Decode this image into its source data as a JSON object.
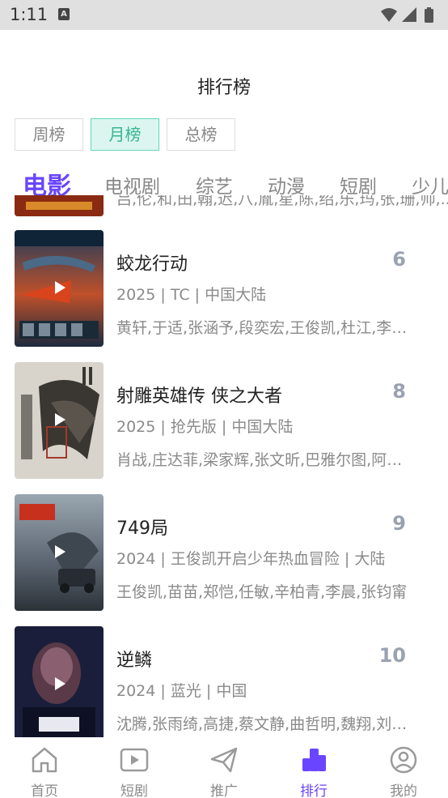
{
  "status_bar": {
    "time": "1:11",
    "notif_letter": "A"
  },
  "page_title": "排行榜",
  "period_tabs": [
    {
      "label": "周榜",
      "active": false
    },
    {
      "label": "月榜",
      "active": true
    },
    {
      "label": "总榜",
      "active": false
    }
  ],
  "category_tabs": [
    {
      "label": "电影",
      "active": true
    },
    {
      "label": "电视剧",
      "active": false
    },
    {
      "label": "综艺",
      "active": false
    },
    {
      "label": "动漫",
      "active": false
    },
    {
      "label": "短剧",
      "active": false
    },
    {
      "label": "少儿",
      "active": false
    }
  ],
  "partial_item": {
    "cast": "吕,伦,和,田,翰,迟,八,胤,星,陈,绍,乐,玛,张,珊,帅,..."
  },
  "items": [
    {
      "title": "蛟龙行动",
      "rank": "6",
      "meta": "2025 | TC | 中国大陆",
      "cast": "黄轩,于适,张涵予,段奕宏,王俊凯,杜江,李晨,彭昱畅"
    },
    {
      "title": "射雕英雄传 侠之大者",
      "rank": "8",
      "meta": "2025 | 抢先版 | 中国大陆",
      "cast": "肖战,庄达菲,梁家辉,张文昕,巴雅尔图,阿如那,胡军"
    },
    {
      "title": "749局",
      "rank": "9",
      "meta": "2024 | 王俊凯开启少年热血冒险 | 大陆",
      "cast": "王俊凯,苗苗,郑恺,任敏,辛柏青,李晨,张钧甯"
    },
    {
      "title": "逆鳞",
      "rank": "10",
      "meta": "2024 | 蓝光 | 中国",
      "cast": "沈腾,张雨绮,高捷,蔡文静,曲哲明,魏翔,刘晓晔"
    }
  ],
  "bottom_nav": [
    {
      "label": "首页",
      "icon": "home-icon",
      "active": false
    },
    {
      "label": "短剧",
      "icon": "play-square-icon",
      "active": false
    },
    {
      "label": "推广",
      "icon": "paper-plane-icon",
      "active": false
    },
    {
      "label": "排行",
      "icon": "ranking-bars-icon",
      "active": true
    },
    {
      "label": "我的",
      "icon": "user-circle-icon",
      "active": false
    }
  ],
  "colors": {
    "accent": "#6a45ff",
    "teal": "#37b592",
    "rank_gray": "#9aa2b1"
  }
}
